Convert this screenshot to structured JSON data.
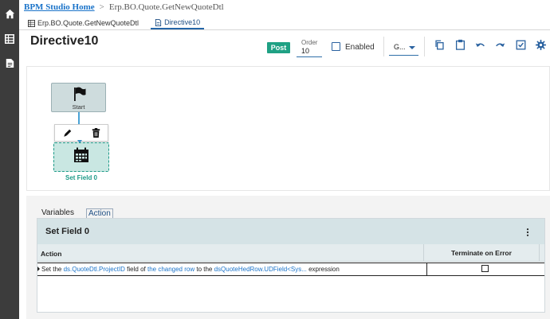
{
  "breadcrumb": {
    "home": "BPM Studio Home",
    "separator": ">",
    "path": "Erp.BO.Quote.GetNewQuoteDtl"
  },
  "tabs": [
    {
      "label": "Erp.BO.Quote.GetNewQuoteDtl",
      "icon": "table-icon",
      "active": false
    },
    {
      "label": "Directive10",
      "icon": "document-icon",
      "active": true
    }
  ],
  "header": {
    "title": "Directive10",
    "status_badge": "Post",
    "order_label": "Order",
    "order_value": "10",
    "enabled_label": "Enabled",
    "enabled": false,
    "group_value": "G..."
  },
  "toolbar": [
    "copy-icon",
    "paste-icon",
    "undo-icon",
    "redo-icon",
    "validate-icon",
    "settings-icon"
  ],
  "canvas": {
    "start_label": "Start",
    "set_field_label": "Set Field 0"
  },
  "bottom_tabs": [
    {
      "label": "Variables",
      "active": false
    },
    {
      "label": "Action",
      "active": true
    }
  ],
  "card": {
    "title": "Set Field 0",
    "columns": {
      "action": "Action",
      "terminate": "Terminate on Error"
    },
    "row": {
      "t1": "Set the ",
      "l1": "ds.QuoteDtl.ProjectID",
      "t2": " field of ",
      "l2": "the changed row",
      "t3": " to the ",
      "l3": "dsQuoteHedRow.UDField<Sys...",
      "t4": " expression",
      "terminate_on_error": false
    }
  },
  "colors": {
    "accent": "#2466a8",
    "post": "#1fa184",
    "node_selected": "#1d9a88",
    "rail": "#3c3c3c"
  }
}
